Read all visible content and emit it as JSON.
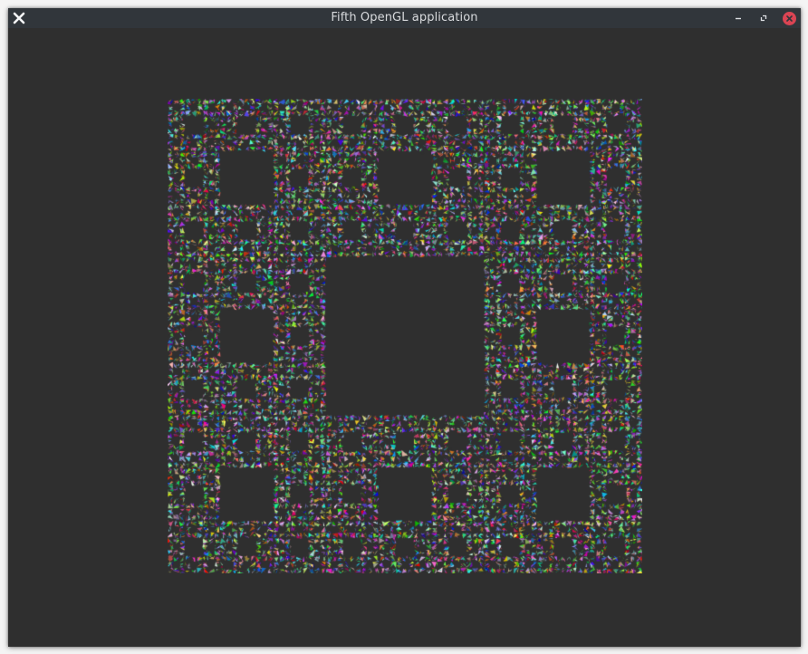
{
  "window": {
    "title": "Fifth OpenGL application",
    "controls": {
      "minimize_icon": "minimize-icon",
      "maximize_icon": "restore-icon",
      "close_icon": "close-icon"
    },
    "app_icon": "x-close-app-icon"
  },
  "canvas": {
    "background_color": "#303030",
    "fractal": {
      "type": "Sierpinski carpet",
      "render": "multicolor noise points"
    }
  },
  "colors": {
    "titlebar_bg": "#31363b",
    "title_text": "#d8dadd",
    "close_button": "#da4453",
    "client_bg": "#2f2f2f"
  }
}
